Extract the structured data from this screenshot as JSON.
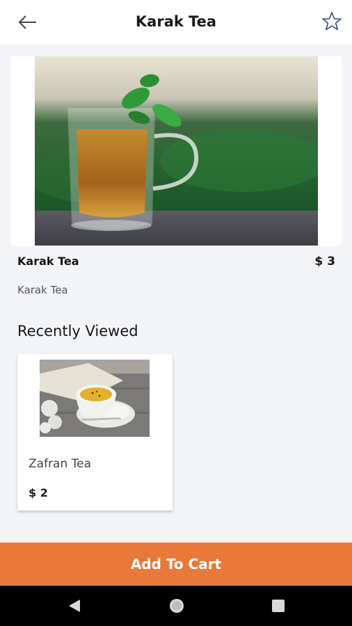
{
  "header": {
    "title": "Karak Tea",
    "back_icon": "arrow-left-icon",
    "favorite_icon": "star-outline-icon"
  },
  "product": {
    "name": "Karak Tea",
    "price": "$ 3",
    "description": "Karak Tea",
    "image": "glass-tea-cup-with-mint-photo"
  },
  "recently_viewed": {
    "title": "Recently Viewed",
    "items": [
      {
        "name": "Zafran Tea",
        "price": "$ 2",
        "image": "saffron-tea-cup-photo"
      }
    ]
  },
  "cart_button": {
    "label": "Add To Cart"
  },
  "colors": {
    "accent": "#e8793a",
    "background": "#f2f4f8"
  },
  "system_nav": {
    "back_icon": "triangle-back-icon",
    "home_icon": "circle-home-icon",
    "recents_icon": "square-recents-icon"
  }
}
